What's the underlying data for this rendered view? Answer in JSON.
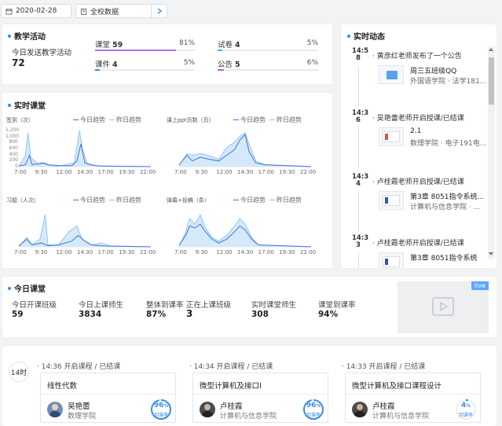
{
  "topbar": {
    "date": "2020-02-28",
    "scope": "全校数据",
    "next_icon": "chevron-right-icon"
  },
  "teaching": {
    "title": "教学活动",
    "today_label": "今日发送教学活动",
    "today_total": "72",
    "items": [
      {
        "label": "课堂",
        "count": "59",
        "pct_text": "81%",
        "pct": 0.81,
        "color": "#a574e8"
      },
      {
        "label": "课件",
        "count": "4",
        "pct_text": "5%",
        "pct": 0.05,
        "color": "#2d8cf0"
      },
      {
        "label": "试卷",
        "count": "4",
        "pct_text": "5%",
        "pct": 0.05,
        "color": "#36b8e0"
      },
      {
        "label": "公告",
        "count": "5",
        "pct_text": "6%",
        "pct": 0.06,
        "color": "#b066d8"
      }
    ]
  },
  "realtime_class": {
    "title": "实时课堂",
    "legend_today": "今日趋势",
    "legend_yesterday": "昨日趋势",
    "color_today": "#4a6fd8",
    "color_yesterday": "#8cc8ef",
    "charts": [
      {
        "title": "签到（次）",
        "yticks": [
          "1,200",
          "1,000",
          "800",
          "600",
          "400",
          "200",
          "0"
        ]
      },
      {
        "title": "课上ppt页数（页）",
        "yticks": []
      },
      {
        "title": "习题（人次）",
        "yticks": []
      },
      {
        "title": "弹幕+投稿（条）",
        "yticks": []
      }
    ],
    "xticks": [
      "7:00",
      "9:30",
      "12:00",
      "14:30",
      "17:00",
      "19:30",
      "22:00"
    ]
  },
  "live_feed": {
    "title": "实时动态",
    "items": [
      {
        "time": "14:5\n8",
        "title": "黄彦红老师发布了一个公告",
        "line1": "周三五班级QQ",
        "line2": "外国语学院 · 法学181..."
      },
      {
        "time": "14:3\n6",
        "title": "吴艳蕾老师开启授课/已结课",
        "line1": "2.1",
        "line2": "数理学院 · 电子191电..."
      },
      {
        "time": "14:3\n4",
        "title": "卢桂霞老师开启授课/已结课",
        "line1": "第3章 8051指令系统...",
        "line2": "计算机与信息学院 · ..."
      },
      {
        "time": "14:3\n3",
        "title": "卢桂霞老师开启授课/已结课",
        "line1": "第3章 8051指令系统",
        "line2": ""
      }
    ]
  },
  "today_class": {
    "title": "今日课堂",
    "live_badge": "live",
    "stats": [
      {
        "label": "今日开课班级",
        "value": "59"
      },
      {
        "label": "今日上课师生",
        "value": "3834"
      },
      {
        "label": "整体到课率",
        "value": "87%"
      },
      {
        "label": "正在上课班级",
        "value": "3"
      },
      {
        "label": "实时课堂师生",
        "value": "308"
      },
      {
        "label": "课堂到课率",
        "value": "94%"
      }
    ]
  },
  "courses": {
    "hour_label": "14时",
    "cards": [
      {
        "time": "14:36",
        "status": "开启课程 / 已结课",
        "name": "线性代数",
        "teacher": "吴艳蕾",
        "college": "数理学院",
        "rate_text": "96",
        "rate_unit": "%",
        "rate": 0.96,
        "rate_label": "到课率"
      },
      {
        "time": "14:34",
        "status": "开启课程 / 已结课",
        "name": "微型计算机及接口I",
        "teacher": "卢桂霞",
        "college": "计算机与信息学院",
        "rate_text": "96",
        "rate_unit": "%",
        "rate": 0.96,
        "rate_label": "到课率"
      },
      {
        "time": "14:33",
        "status": "开启课程 / 已结课",
        "name": "微型计算机及接口课程设计",
        "teacher": "卢桂霞",
        "college": "计算机与信息学院",
        "rate_text": "4",
        "rate_unit": "%",
        "rate": 0.04,
        "rate_label": "到课率"
      }
    ]
  }
}
